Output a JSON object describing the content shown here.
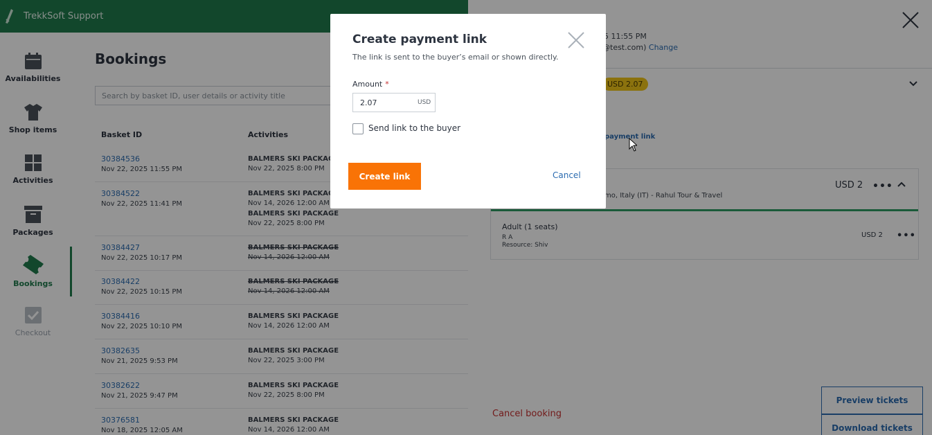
{
  "app": {
    "brand": "TrekkSoft Support"
  },
  "sidebar": {
    "items": [
      {
        "label": "Availabilities",
        "icon": "calendar-icon"
      },
      {
        "label": "Shop items",
        "icon": "shirt-icon"
      },
      {
        "label": "Activities",
        "icon": "grid-icon"
      },
      {
        "label": "Packages",
        "icon": "box-icon"
      },
      {
        "label": "Bookings",
        "icon": "ticket-icon",
        "active": true
      },
      {
        "label": "Checkout",
        "icon": "checkout-icon",
        "disabled": true
      }
    ]
  },
  "bookings": {
    "title": "Bookings",
    "search_placeholder": "Search by basket ID, user details or activity title",
    "columns": [
      "Basket ID",
      "Activities"
    ],
    "rows": [
      {
        "id": "30384536",
        "date": "Nov 22, 2025 11:55 PM",
        "activities": [
          {
            "name": "BALMERS SKI PACKAGE",
            "date": "Nov 22, 2025 8:00 PM"
          }
        ]
      },
      {
        "id": "30384522",
        "date": "Nov 22, 2025 11:41 PM",
        "activities": [
          {
            "name": "BALMERS SKI PACKAGE",
            "date": "Nov 14, 2026 12:00 AM"
          },
          {
            "name": "BALMERS SKI PACKAGE",
            "date": "Nov 22, 2025 8:00 PM"
          }
        ]
      },
      {
        "id": "30384427",
        "date": "Nov 22, 2025 10:17 PM",
        "activities": [
          {
            "name": "BALMERS SKI PACKAGE",
            "date": "Nov 14, 2026 12:00 AM",
            "cancelled": true
          }
        ]
      },
      {
        "id": "30384422",
        "date": "Nov 22, 2025 10:15 PM",
        "activities": [
          {
            "name": "BALMERS SKI PACKAGE",
            "date": "Nov 14, 2026 12:00 AM",
            "cancelled": true
          }
        ]
      },
      {
        "id": "30384416",
        "date": "Nov 22, 2025 10:10 PM",
        "activities": [
          {
            "name": "BALMERS SKI PACKAGE",
            "date": "Nov 14, 2026 12:00 AM"
          }
        ]
      },
      {
        "id": "30382635",
        "date": "Nov 21, 2025 9:53 PM",
        "activities": [
          {
            "name": "BALMERS SKI PACKAGE",
            "date": "Nov 22, 2025 3:00 PM"
          }
        ]
      },
      {
        "id": "30382622",
        "date": "Nov 21, 2025 9:47 PM",
        "activities": [
          {
            "name": "BALMERS SKI PACKAGE",
            "date": "Nov 22, 2025 8:00 PM"
          }
        ]
      },
      {
        "id": "30376581",
        "date": "Nov 18, 2025 12:05 AM",
        "activities": [
          {
            "name": "BALMERS SKI PACKAGE",
            "date": "Nov 14, 2026 12:00 AM"
          }
        ]
      }
    ]
  },
  "detail": {
    "datetime_partial": "5 11:55 PM",
    "email_partial": "@test.com)",
    "change_label": "Change",
    "amount_badge": "USD 2.07",
    "payment_link_partial": "payment link",
    "location_partial": "mo, Italy (IT) - Rahul Tour & Travel",
    "price": "USD 2",
    "seat_label": "Adult (1 seats)",
    "person": "R A",
    "resource": "Resource: Shiv",
    "seat_price": "USD 2",
    "cancel_booking": "Cancel booking",
    "preview_tickets": "Preview tickets",
    "download_tickets": "Download tickets"
  },
  "modal": {
    "title": "Create payment link",
    "subtitle": "The link is sent to the buyer’s email or shown directly.",
    "amount_label": "Amount",
    "required_mark": "*",
    "amount_value": "2.07",
    "currency": "USD",
    "send_link_label": "Send link to the buyer",
    "send_link_checked": false,
    "create_label": "Create link",
    "cancel_label": "Cancel"
  },
  "colors": {
    "brand_green": "#1f7a4c",
    "accent_orange": "#f97306",
    "link_blue": "#2b6cb0",
    "danger_red": "#c53030",
    "badge_yellow": "#f0c419"
  }
}
